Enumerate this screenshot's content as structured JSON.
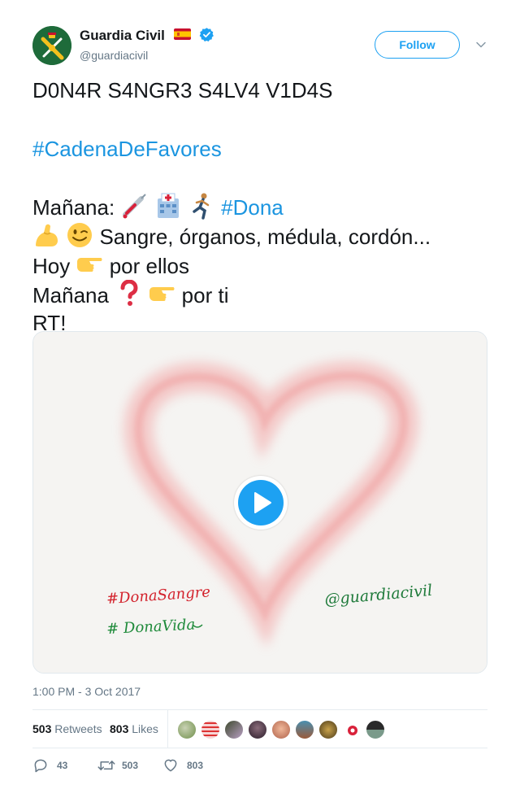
{
  "account": {
    "display_name": "Guardia Civil",
    "handle": "@guardiacivil",
    "verified": true,
    "flag_icon": "spain-flag-icon",
    "follow_label": "Follow"
  },
  "tweet": {
    "line1": "D0N4R S4NGR3 S4LV4 V1D4S",
    "hashtag_cadena": "#CadenaDeFavores",
    "manana_label": "Mañana:",
    "hashtag_dona": "#Dona",
    "organs_text": "Sangre, órganos, médula, cordón...",
    "hoy_label": "Hoy",
    "por_ellos": "por ellos",
    "manana2_label": "Mañana",
    "por_ti": "por ti",
    "rt": "RT!",
    "emojis": [
      "syringe-icon",
      "hospital-icon",
      "runner-icon",
      "flexed-biceps-icon",
      "winking-face-icon",
      "pointing-right-icon",
      "question-mark-icon",
      "pointing-right-icon"
    ]
  },
  "media": {
    "type": "video",
    "handwriting_left_1": "#DonaSangre",
    "handwriting_left_2": "# DonaVida",
    "handwriting_right": "@guardiacivil",
    "play_icon": "play-icon"
  },
  "meta": {
    "timestamp": "1:00 PM - 3 Oct 2017"
  },
  "stats": {
    "retweets_count": "503",
    "retweets_label": "Retweets",
    "likes_count": "803",
    "likes_label": "Likes"
  },
  "actions": {
    "reply_count": "43",
    "retweet_count": "503",
    "like_count": "803"
  },
  "colors": {
    "link": "#1b95e0",
    "accent": "#1da1f2",
    "muted": "#657786",
    "text": "#14171a",
    "heart": "#f2a9a9"
  }
}
